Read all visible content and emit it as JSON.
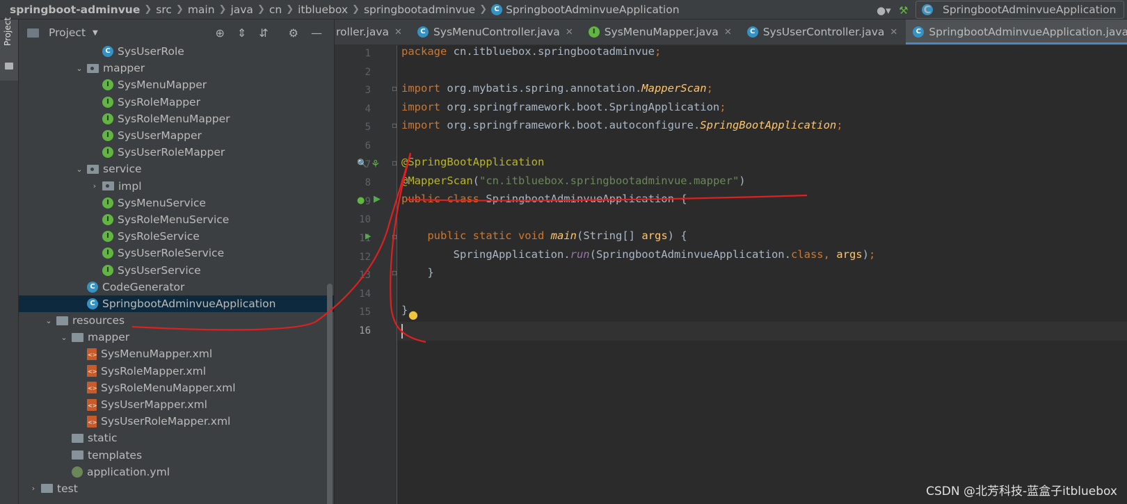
{
  "navbar": {
    "crumbs": [
      "springboot-adminvue",
      "src",
      "main",
      "java",
      "cn",
      "itbluebox",
      "springbootadminvue",
      "SpringbootAdminvueApplication"
    ],
    "run_config": "SpringbootAdminvueApplication"
  },
  "left_strip": {
    "label": "Project"
  },
  "project_panel": {
    "title": "Project",
    "tree": [
      {
        "label": "SysUserRole",
        "icon": "class-icon",
        "indent": 4,
        "arrow": ""
      },
      {
        "label": "mapper",
        "icon": "package-folder-icon",
        "indent": 3,
        "arrow": "down"
      },
      {
        "label": "SysMenuMapper",
        "icon": "interface-icon",
        "indent": 4,
        "arrow": ""
      },
      {
        "label": "SysRoleMapper",
        "icon": "interface-icon",
        "indent": 4,
        "arrow": ""
      },
      {
        "label": "SysRoleMenuMapper",
        "icon": "interface-icon",
        "indent": 4,
        "arrow": ""
      },
      {
        "label": "SysUserMapper",
        "icon": "interface-icon",
        "indent": 4,
        "arrow": ""
      },
      {
        "label": "SysUserRoleMapper",
        "icon": "interface-icon",
        "indent": 4,
        "arrow": ""
      },
      {
        "label": "service",
        "icon": "package-folder-icon",
        "indent": 3,
        "arrow": "down"
      },
      {
        "label": "impl",
        "icon": "package-folder-icon",
        "indent": 4,
        "arrow": "right"
      },
      {
        "label": "SysMenuService",
        "icon": "interface-icon",
        "indent": 4,
        "arrow": ""
      },
      {
        "label": "SysRoleMenuService",
        "icon": "interface-icon",
        "indent": 4,
        "arrow": ""
      },
      {
        "label": "SysRoleService",
        "icon": "interface-icon",
        "indent": 4,
        "arrow": ""
      },
      {
        "label": "SysUserRoleService",
        "icon": "interface-icon",
        "indent": 4,
        "arrow": ""
      },
      {
        "label": "SysUserService",
        "icon": "interface-icon",
        "indent": 4,
        "arrow": ""
      },
      {
        "label": "CodeGenerator",
        "icon": "class-icon",
        "indent": 3,
        "arrow": ""
      },
      {
        "label": "SpringbootAdminvueApplication",
        "icon": "spring-class-icon",
        "indent": 3,
        "arrow": "",
        "selected": true
      },
      {
        "label": "resources",
        "icon": "resources-folder-icon",
        "indent": 1,
        "arrow": "down"
      },
      {
        "label": "mapper",
        "icon": "folder-icon",
        "indent": 2,
        "arrow": "down"
      },
      {
        "label": "SysMenuMapper.xml",
        "icon": "xml-file-icon",
        "indent": 3,
        "arrow": ""
      },
      {
        "label": "SysRoleMapper.xml",
        "icon": "xml-file-icon",
        "indent": 3,
        "arrow": ""
      },
      {
        "label": "SysRoleMenuMapper.xml",
        "icon": "xml-file-icon",
        "indent": 3,
        "arrow": ""
      },
      {
        "label": "SysUserMapper.xml",
        "icon": "xml-file-icon",
        "indent": 3,
        "arrow": ""
      },
      {
        "label": "SysUserRoleMapper.xml",
        "icon": "xml-file-icon",
        "indent": 3,
        "arrow": ""
      },
      {
        "label": "static",
        "icon": "folder-icon",
        "indent": 2,
        "arrow": ""
      },
      {
        "label": "templates",
        "icon": "folder-icon",
        "indent": 2,
        "arrow": ""
      },
      {
        "label": "application.yml",
        "icon": "yaml-file-icon",
        "indent": 2,
        "arrow": ""
      },
      {
        "label": "test",
        "icon": "folder-icon",
        "indent": 0,
        "arrow": "right"
      }
    ]
  },
  "tabs": [
    {
      "label": "roller.java",
      "icon": "",
      "active": false
    },
    {
      "label": "SysMenuController.java",
      "icon": "class-icon",
      "active": false
    },
    {
      "label": "SysMenuMapper.java",
      "icon": "interface-icon",
      "active": false
    },
    {
      "label": "SysUserController.java",
      "icon": "class-icon",
      "active": false
    },
    {
      "label": "SpringbootAdminvueApplication.java",
      "icon": "spring-class-icon",
      "active": true
    }
  ],
  "editor": {
    "line_numbers": [
      "1",
      "2",
      "3",
      "4",
      "5",
      "6",
      "7",
      "8",
      "9",
      "10",
      "11",
      "12",
      "13",
      "14",
      "15",
      "16"
    ],
    "current_line": "16",
    "code": {
      "l1_kw": "package",
      "l1_rest": " cn.itbluebox.springbootadminvue",
      "import_kw": "import",
      "l3_pkg": " org.mybatis.spring.annotation.",
      "l3_cls": "MapperScan",
      "l4_pkg": " org.springframework.boot.SpringApplication",
      "l5_pkg": " org.springframework.boot.autoconfigure.",
      "l5_cls": "SpringBootApplication",
      "l7_ann": "@SpringBootApplication",
      "l8_ann": "@MapperScan",
      "l8_str": "\"cn.itbluebox.springbootadminvue.mapper\"",
      "l9_kw": "public class",
      "l9_name": " SpringbootAdminvueApplication ",
      "l11_kw": "public static void",
      "l11_fn": "main",
      "l11_type": "String",
      "l11_arg": "args",
      "l12_cls": "SpringApplication",
      "l12_fn": "run",
      "l12_arg_cls": "SpringbootAdminvueApplication",
      "l12_kw": "class",
      "l12_arg": "args"
    }
  },
  "watermark": "CSDN @北芳科技-蓝盒子itbluebox",
  "colors": {
    "keyword": "#cc7832",
    "annotation": "#bbb529",
    "string": "#6a8759",
    "function": "#ffc66d",
    "text": "#a9b7c6",
    "selection": "#0d293e",
    "ink": "#e02020"
  }
}
